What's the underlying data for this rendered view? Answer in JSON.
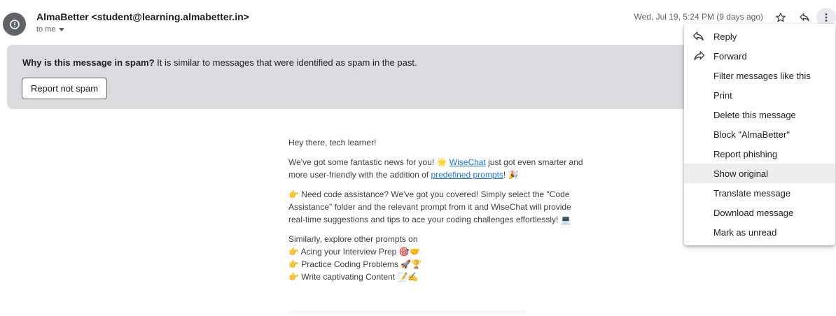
{
  "header": {
    "avatar_icon": "alert-circle-icon",
    "sender": "AlmaBetter <student@learning.almabetter.in>",
    "to_me": "to me",
    "datetime": "Wed, Jul 19, 5:24 PM (9 days ago)"
  },
  "spam_banner": {
    "title": "Why is this message in spam?",
    "reason": " It is similar to messages that were identified as spam in the past.",
    "button": "Report not spam",
    "bg_color": "#dadce0"
  },
  "email_body": {
    "greeting": "Hey there, tech learner!",
    "p1_a": "We've got some fantastic news for you! ",
    "p1_emoji1": "🌟",
    "p1_link1": "WiseChat",
    "p1_b": " just got even smarter and more user-friendly with the addition of ",
    "p1_link2": "predefined prompts",
    "p1_c": "! ",
    "p1_emoji2": "🎉",
    "p2_emoji": "👉",
    "p2_text": " Need code assistance? We've got you covered! Simply select the \"Code Assistance\" folder and the relevant prompt from it and WiseChat will provide real-time suggestions and tips to ace your coding challenges effortlessly! ",
    "p2_emoji2": "💻",
    "p3_intro": "Similarly, explore other prompts on",
    "list": [
      {
        "emoji": "👉",
        "text": " Acing your Interview Prep ",
        "tail": "🎯🤝"
      },
      {
        "emoji": "👉",
        "text": " Practice Coding Problems ",
        "tail": "🚀🏆"
      },
      {
        "emoji": "👉",
        "text": " Write captivating Content ",
        "tail": "📝✍"
      }
    ]
  },
  "menu": {
    "items": [
      {
        "label": "Reply",
        "icon": "reply-icon"
      },
      {
        "label": "Forward",
        "icon": "forward-icon"
      },
      {
        "label": "Filter messages like this",
        "icon": ""
      },
      {
        "label": "Print",
        "icon": ""
      },
      {
        "label": "Delete this message",
        "icon": ""
      },
      {
        "label": "Block \"AlmaBetter\"",
        "icon": ""
      },
      {
        "label": "Report phishing",
        "icon": ""
      },
      {
        "label": "Show original",
        "icon": "",
        "highlighted": true
      },
      {
        "label": "Translate message",
        "icon": ""
      },
      {
        "label": "Download message",
        "icon": ""
      },
      {
        "label": "Mark as unread",
        "icon": ""
      }
    ]
  }
}
